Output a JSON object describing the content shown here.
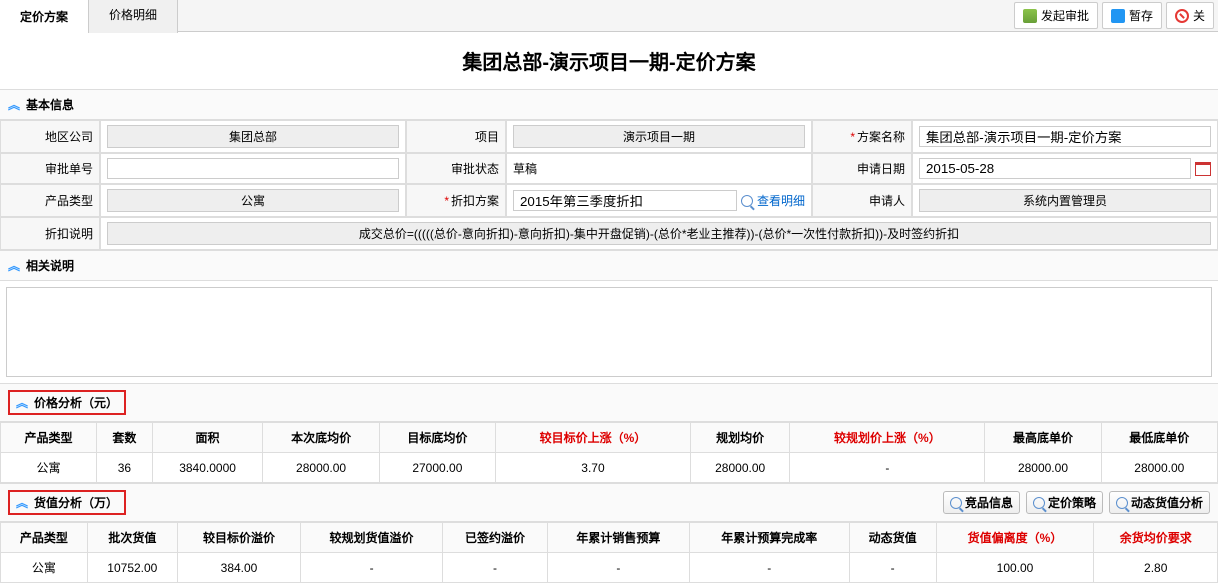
{
  "tabs": {
    "t0": "定价方案",
    "t1": "价格明细"
  },
  "toolbar": {
    "approve": "发起审批",
    "save": "暂存",
    "close": "关"
  },
  "page_title": "集团总部-演示项目一期-定价方案",
  "sections": {
    "basic": "基本信息",
    "related": "相关说明",
    "price": "价格分析（元）",
    "value": "货值分析（万）"
  },
  "form": {
    "region_company_lbl": "地区公司",
    "region_company": "集团总部",
    "project_lbl": "项目",
    "project": "演示项目一期",
    "plan_name_lbl": "方案名称",
    "plan_name": "集团总部-演示项目一期-定价方案",
    "approval_no_lbl": "审批单号",
    "approval_no": "",
    "approval_status_lbl": "审批状态",
    "approval_status": "草稿",
    "apply_date_lbl": "申请日期",
    "apply_date": "2015-05-28",
    "product_type_lbl": "产品类型",
    "product_type": "公寓",
    "discount_plan_lbl": "折扣方案",
    "discount_plan": "2015年第三季度折扣",
    "view_detail": "查看明细",
    "applicant_lbl": "申请人",
    "applicant": "系统内置管理员",
    "discount_desc_lbl": "折扣说明",
    "discount_desc": "成交总价=(((((总价-意向折扣)-意向折扣)-集中开盘促销)-(总价*老业主推荐))-(总价*一次性付款折扣))-及时签约折扣"
  },
  "price_table": {
    "headers": [
      "产品类型",
      "套数",
      "面积",
      "本次底均价",
      "目标底均价",
      "较目标价上涨（%）",
      "规划均价",
      "较规划价上涨（%）",
      "最高底单价",
      "最低底单价"
    ],
    "red_cols": [
      5,
      7
    ],
    "row": [
      "公寓",
      "36",
      "3840.0000",
      "28000.00",
      "27000.00",
      "3.70",
      "28000.00",
      "-",
      "28000.00",
      "28000.00"
    ]
  },
  "value_table": {
    "headers": [
      "产品类型",
      "批次货值",
      "较目标价溢价",
      "较规划货值溢价",
      "已签约溢价",
      "年累计销售预算",
      "年累计预算完成率",
      "动态货值",
      "货值偏离度（%）",
      "余货均价要求"
    ],
    "red_cols": [
      8,
      9
    ],
    "row": [
      "公寓",
      "10752.00",
      "384.00",
      "-",
      "-",
      "-",
      "-",
      "-",
      "100.00",
      "2.80"
    ]
  },
  "value_actions": {
    "a0": "竞品信息",
    "a1": "定价策略",
    "a2": "动态货值分析"
  }
}
